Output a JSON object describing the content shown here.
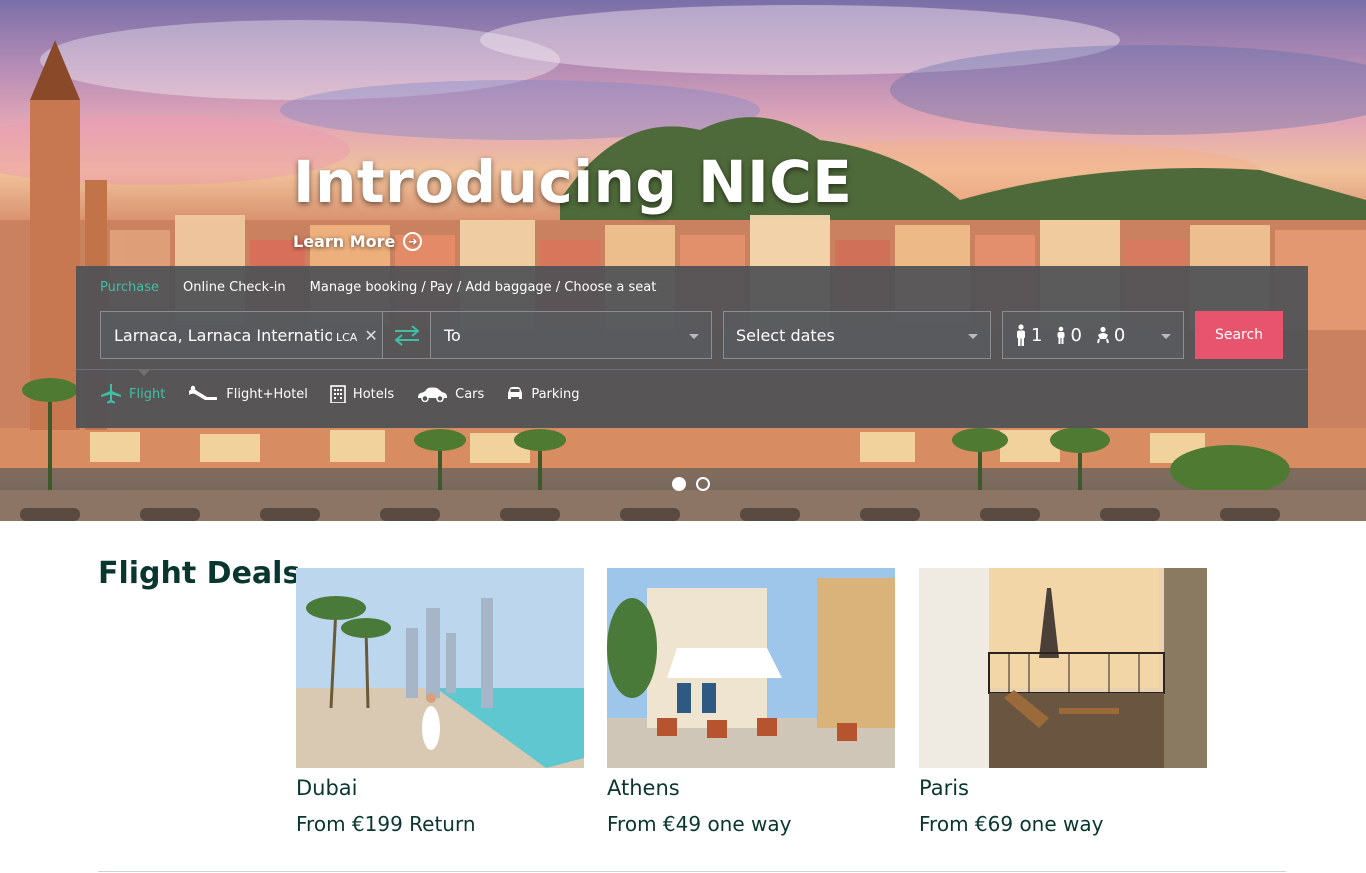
{
  "hero": {
    "title": "Introducing NICE",
    "learn_more": "Learn More",
    "slides": 2,
    "active_slide": 1
  },
  "booking": {
    "tabs": [
      {
        "label": "Purchase",
        "active": true
      },
      {
        "label": "Online Check-in",
        "active": false
      },
      {
        "label": "Manage booking / Pay / Add baggage / Choose a seat",
        "active": false
      }
    ],
    "from": {
      "value": "Larnaca, Larnaca International",
      "code": "LCA"
    },
    "to": {
      "placeholder": "To"
    },
    "dates": {
      "placeholder": "Select dates"
    },
    "passengers": {
      "adults": "1",
      "children": "0",
      "infants": "0"
    },
    "search_label": "Search",
    "products": [
      {
        "label": "Flight",
        "icon": "plane-icon",
        "active": true
      },
      {
        "label": "Flight+Hotel",
        "icon": "sunbed-icon",
        "active": false
      },
      {
        "label": "Hotels",
        "icon": "building-icon",
        "active": false
      },
      {
        "label": "Cars",
        "icon": "car-icon",
        "active": false
      },
      {
        "label": "Parking",
        "icon": "parking-car-icon",
        "active": false
      }
    ]
  },
  "deals": {
    "title": "Flight Deals",
    "items": [
      {
        "city": "Dubai",
        "price": "From €199 Return"
      },
      {
        "city": "Athens",
        "price": "From €49 one way"
      },
      {
        "city": "Paris",
        "price": "From €69 one way"
      }
    ]
  },
  "colors": {
    "accent": "#3fbfa6",
    "search": "#e8546e",
    "text": "#0a3630"
  }
}
